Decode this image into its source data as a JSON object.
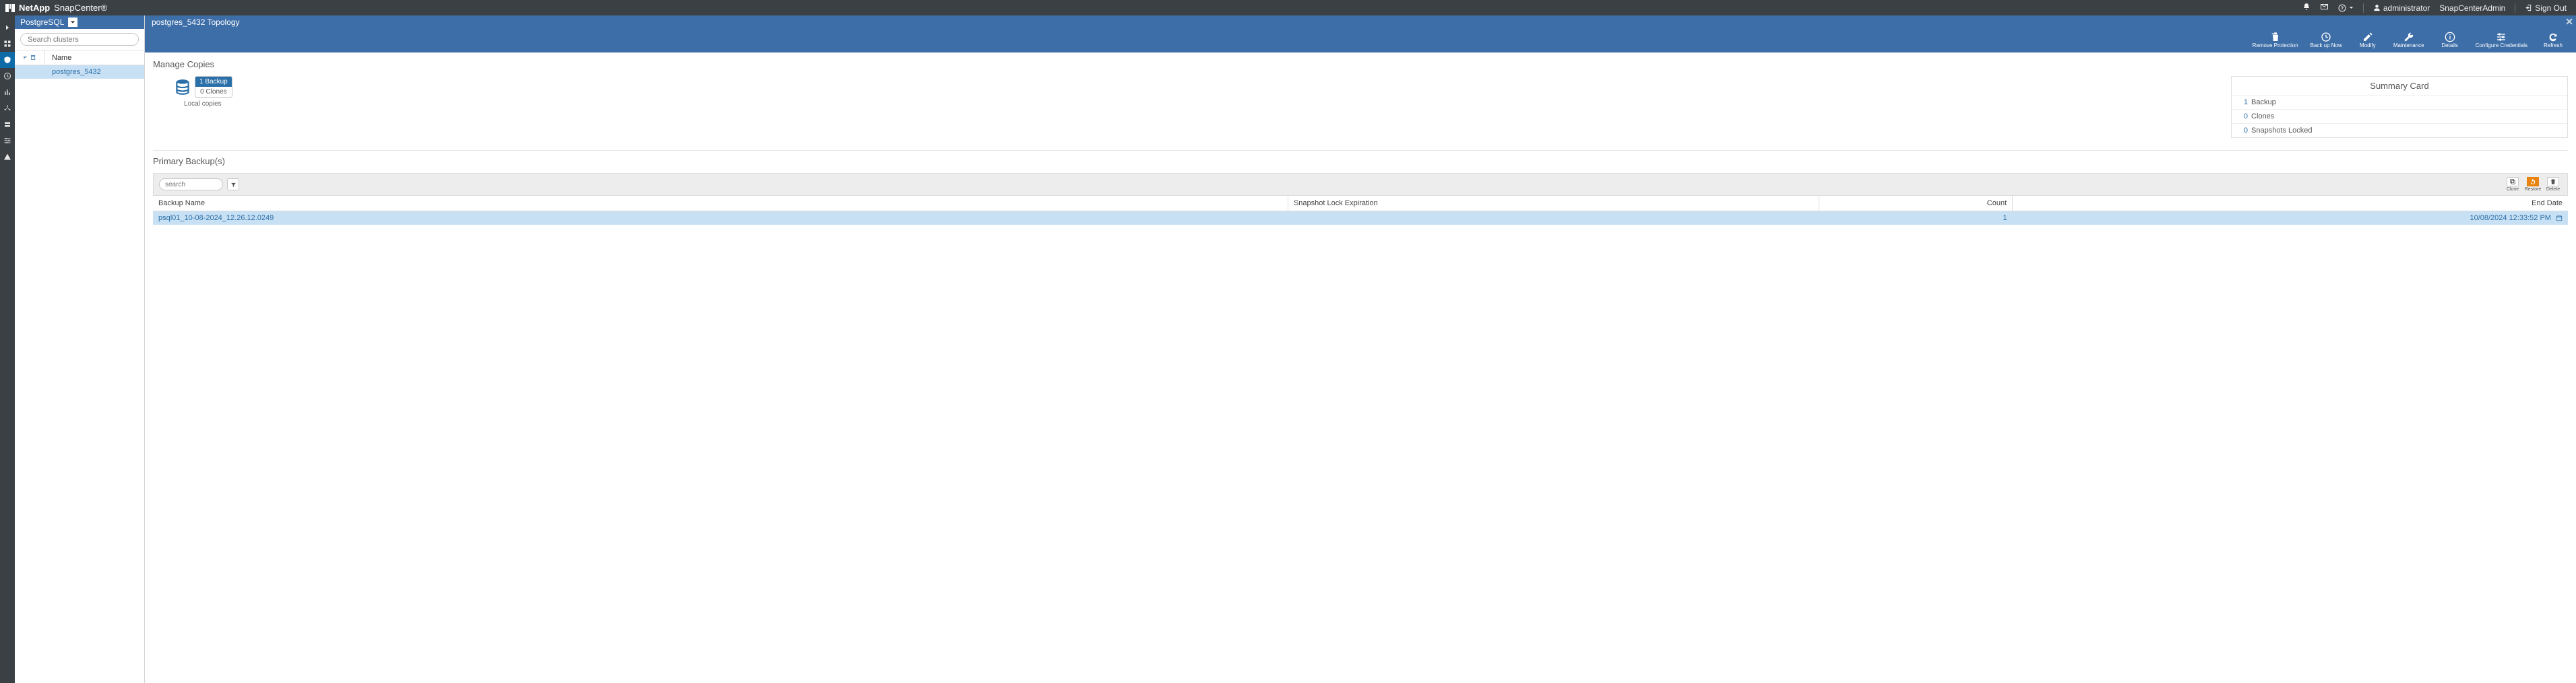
{
  "brand": {
    "company": "NetApp",
    "product": "SnapCenter®"
  },
  "topbar": {
    "user": "administrator",
    "role": "SnapCenterAdmin",
    "signout": "Sign Out"
  },
  "sidecol": {
    "plugin": "PostgreSQL",
    "search_placeholder": "Search clusters",
    "name_col": "Name",
    "cluster": "postgres_5432"
  },
  "banner": {
    "title": "postgres_5432 Topology",
    "actions": {
      "remove": "Remove Protection",
      "backup": "Back up Now",
      "modify": "Modify",
      "maint": "Maintenance",
      "details": "Details",
      "creds": "Configure Credentials",
      "refresh": "Refresh"
    }
  },
  "copies": {
    "title": "Manage Copies",
    "pill_top": "1 Backup",
    "pill_bot": "0 Clones",
    "local_label": "Local copies"
  },
  "summary": {
    "title": "Summary Card",
    "l1n": "1",
    "l1t": "Backup",
    "l2n": "0",
    "l2t": "Clones",
    "l3n": "0",
    "l3t": "Snapshots Locked"
  },
  "pb": {
    "title": "Primary Backup(s)",
    "search_placeholder": "search",
    "act_clone": "Clone",
    "act_restore": "Restore",
    "act_delete": "Delete",
    "cols": {
      "name": "Backup Name",
      "lock": "Snapshot Lock Expiration",
      "count": "Count",
      "end": "End Date"
    },
    "row": {
      "name": "psql01_10-08-2024_12.26.12.0249",
      "lock": "",
      "count": "1",
      "end": "10/08/2024 12:33:52 PM"
    }
  }
}
